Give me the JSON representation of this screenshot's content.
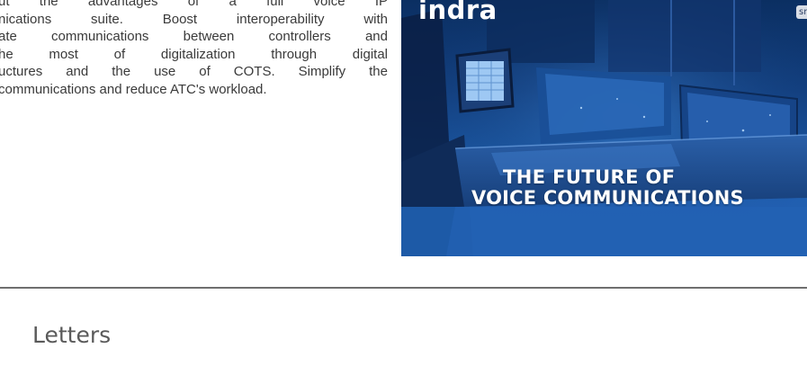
{
  "article": {
    "lines": [
      "ut the advantages of a full voice IP",
      "nications suite. Boost interoperability with",
      "ate communications between controllers and",
      "he most of digitalization through digital",
      "uctures and the use of COTS. Simplify the",
      "communications and reduce ATC's workload."
    ]
  },
  "video": {
    "brand": "indra",
    "badge": "sr",
    "headline_line1": "THE FUTURE OF",
    "headline_line2": "VOICE COMMUNICATIONS"
  },
  "section": {
    "heading": "Letters"
  }
}
